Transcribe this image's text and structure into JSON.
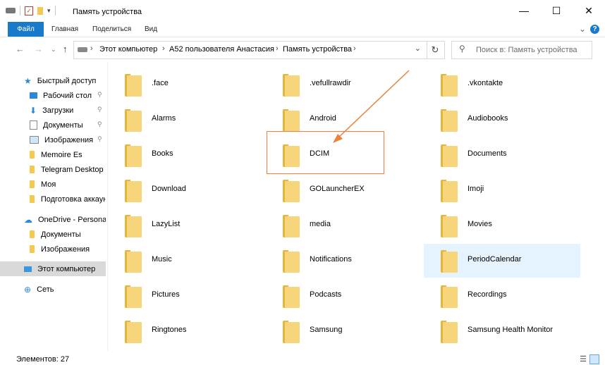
{
  "window": {
    "title": "Память устройства",
    "controls": {
      "minimize": "—",
      "maximize": "☐",
      "close": "✕"
    }
  },
  "ribbon": {
    "tabs": [
      "Файл",
      "Главная",
      "Поделиться",
      "Вид"
    ]
  },
  "address": {
    "crumbs": [
      "Этот компьютер",
      "A52 пользователя Анастасия",
      "Память устройства"
    ],
    "search_placeholder": "Поиск в: Память устройства"
  },
  "sidebar": {
    "items": [
      {
        "label": "Быстрый доступ",
        "icon": "star-icon",
        "pinned": false
      },
      {
        "label": "Рабочий стол",
        "icon": "desktop-icon",
        "pinned": true
      },
      {
        "label": "Загрузки",
        "icon": "download-icon",
        "pinned": true
      },
      {
        "label": "Документы",
        "icon": "documents-icon",
        "pinned": true
      },
      {
        "label": "Изображения",
        "icon": "pictures-icon",
        "pinned": true
      },
      {
        "label": "Memoire Es",
        "icon": "folder-icon",
        "pinned": false
      },
      {
        "label": "Telegram Desktop",
        "icon": "folder-icon",
        "pinned": false
      },
      {
        "label": "Моя",
        "icon": "folder-icon",
        "pinned": false
      },
      {
        "label": "Подготовка аккаун",
        "icon": "folder-icon",
        "pinned": false
      },
      {
        "label": "OneDrive - Personal",
        "icon": "cloud-icon",
        "pinned": false
      },
      {
        "label": "Документы",
        "icon": "folder-icon",
        "pinned": false
      },
      {
        "label": "Изображения",
        "icon": "folder-icon",
        "pinned": false
      },
      {
        "label": "Этот компьютер",
        "icon": "computer-icon",
        "pinned": false
      },
      {
        "label": "Сеть",
        "icon": "network-icon",
        "pinned": false
      }
    ]
  },
  "folders": [
    ".face",
    ".vefullrawdir",
    ".vkontakte",
    "Alarms",
    "Android",
    "Audiobooks",
    "Books",
    "DCIM",
    "Documents",
    "Download",
    "GOLauncherEX",
    "Imoji",
    "LazyList",
    "media",
    "Movies",
    "Music",
    "Notifications",
    "PeriodCalendar",
    "Pictures",
    "Podcasts",
    "Recordings",
    "Ringtones",
    "Samsung",
    "Samsung Health Monitor"
  ],
  "selected_folder": "PeriodCalendar",
  "highlighted_folder": "DCIM",
  "status": {
    "text": "Элементов: 27"
  },
  "colors": {
    "accent": "#1979ca",
    "folder": "#f7d57a",
    "annotation": "#e8823d",
    "selection": "#e5f3ff"
  }
}
